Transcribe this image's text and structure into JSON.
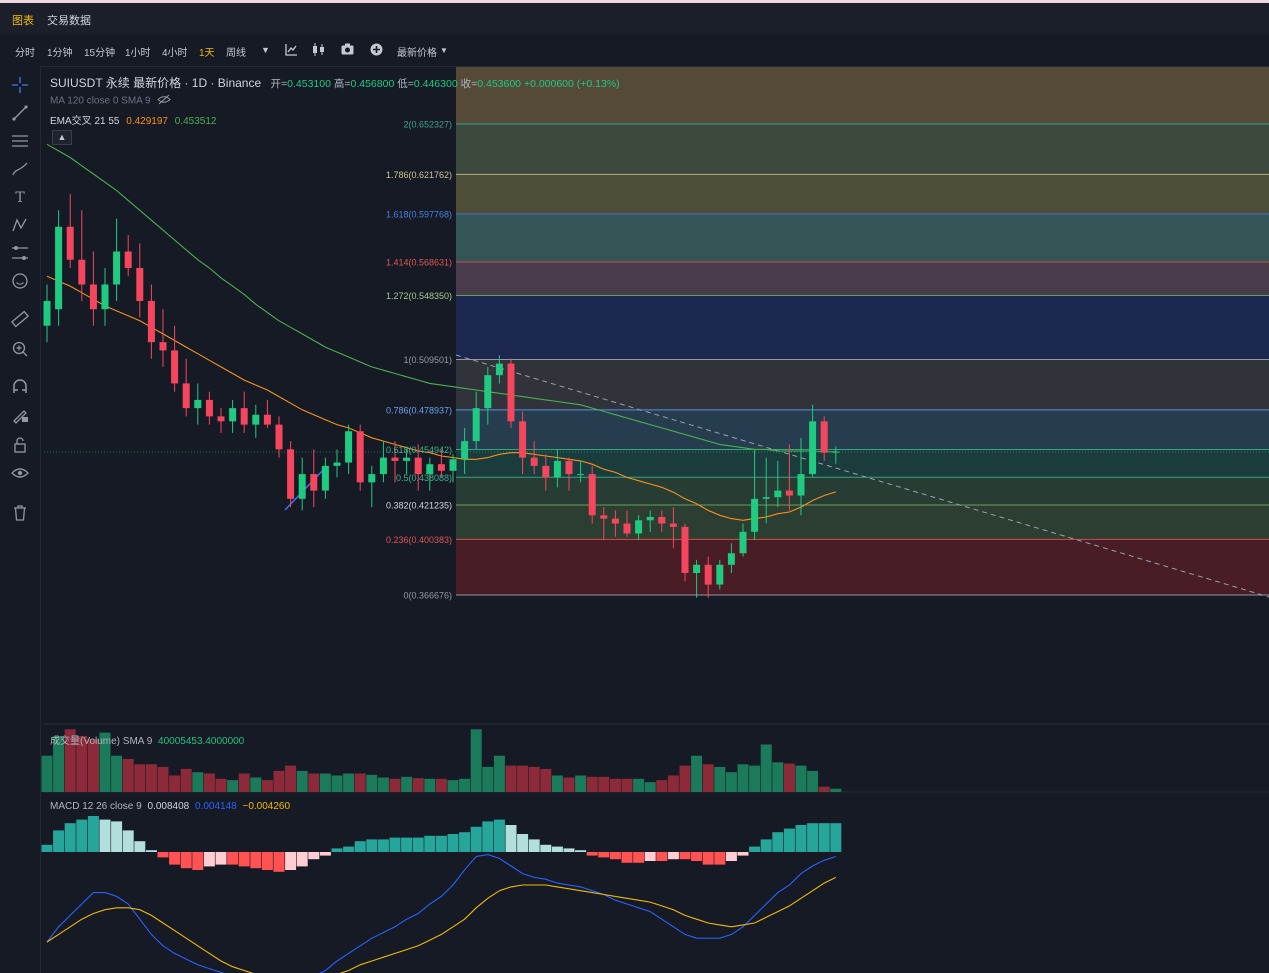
{
  "header_tabs": [
    "图表",
    "交易数据"
  ],
  "timeframes": [
    "分时",
    "1分钟",
    "15分钟",
    "1小时",
    "4小时",
    "1天",
    "周线"
  ],
  "active_timeframe": "1天",
  "price_type_label": "最新价格",
  "legend": {
    "symbol": "SUIUSDT 永续 最新价格 · 1D · Binance",
    "open_label": "开=",
    "open": "0.453100",
    "high_label": "高=",
    "high": "0.456800",
    "low_label": "低=",
    "low": "0.446300",
    "close_label": "收=",
    "close": "0.453600",
    "change": "+0.000600 (+0.13%)",
    "ma_line": "MA 120 close 0 SMA 9",
    "ema_label": "EMA交叉 21 55",
    "ema21": "0.429197",
    "ema55": "0.453512"
  },
  "volume_legend": {
    "label": "成交量(Volume) SMA 9",
    "value": "40005453.4000000"
  },
  "macd_legend": {
    "label": "MACD 12 26 close 9",
    "macd": "0.008408",
    "signal": "0.004148",
    "hist": "−0.004260"
  },
  "colors": {
    "up": "#26a69a",
    "down": "#ef5350",
    "up_candle": "#1ecb81",
    "down_candle": "#f6465d",
    "ema21": "#f7931a",
    "ema55": "#4caf50",
    "macd": "#2962ff",
    "signal": "#f0b90b"
  },
  "chart_data": {
    "type": "candlestick",
    "title": "SUIUSDT 永续 最新价格 · 1D · Binance",
    "fibonacci": [
      {
        "ratio": "2",
        "price": 0.652327,
        "label": "2(0.652327)"
      },
      {
        "ratio": "1.786",
        "price": 0.621762,
        "label": "1.786(0.621762)"
      },
      {
        "ratio": "1.618",
        "price": 0.597768,
        "label": "1.618(0.597768)"
      },
      {
        "ratio": "1.414",
        "price": 0.568631,
        "label": "1.414(0.568631)"
      },
      {
        "ratio": "1.272",
        "price": 0.54835,
        "label": "1.272(0.548350)"
      },
      {
        "ratio": "1",
        "price": 0.509501,
        "label": "1(0.509501)"
      },
      {
        "ratio": "0.786",
        "price": 0.478937,
        "label": "0.786(0.478937)"
      },
      {
        "ratio": "0.618",
        "price": 0.454942,
        "label": "0.618(0.454942)"
      },
      {
        "ratio": "0.5",
        "price": 0.438088,
        "label": "0.5(0.438088)"
      },
      {
        "ratio": "0.382",
        "price": 0.421235,
        "label": "0.382(0.421235)"
      },
      {
        "ratio": "0.236",
        "price": 0.400383,
        "label": "0.236(0.400383)"
      },
      {
        "ratio": "0",
        "price": 0.366676,
        "label": "0(0.366676)"
      }
    ],
    "ohlc": [
      [
        0.53,
        0.555,
        0.52,
        0.545
      ],
      [
        0.54,
        0.6,
        0.53,
        0.59
      ],
      [
        0.59,
        0.61,
        0.565,
        0.57
      ],
      [
        0.57,
        0.6,
        0.545,
        0.555
      ],
      [
        0.555,
        0.575,
        0.53,
        0.54
      ],
      [
        0.54,
        0.565,
        0.53,
        0.555
      ],
      [
        0.555,
        0.595,
        0.545,
        0.575
      ],
      [
        0.575,
        0.585,
        0.56,
        0.565
      ],
      [
        0.565,
        0.58,
        0.535,
        0.545
      ],
      [
        0.545,
        0.555,
        0.51,
        0.52
      ],
      [
        0.52,
        0.54,
        0.505,
        0.515
      ],
      [
        0.515,
        0.53,
        0.49,
        0.495
      ],
      [
        0.495,
        0.51,
        0.475,
        0.48
      ],
      [
        0.48,
        0.495,
        0.47,
        0.485
      ],
      [
        0.485,
        0.49,
        0.47,
        0.475
      ],
      [
        0.475,
        0.48,
        0.465,
        0.472
      ],
      [
        0.472,
        0.485,
        0.465,
        0.48
      ],
      [
        0.48,
        0.49,
        0.465,
        0.47
      ],
      [
        0.47,
        0.482,
        0.462,
        0.476
      ],
      [
        0.476,
        0.485,
        0.468,
        0.47
      ],
      [
        0.47,
        0.475,
        0.45,
        0.455
      ],
      [
        0.455,
        0.46,
        0.42,
        0.425
      ],
      [
        0.425,
        0.45,
        0.418,
        0.44
      ],
      [
        0.44,
        0.455,
        0.42,
        0.43
      ],
      [
        0.43,
        0.45,
        0.425,
        0.445
      ],
      [
        0.445,
        0.455,
        0.438,
        0.447
      ],
      [
        0.447,
        0.47,
        0.44,
        0.466
      ],
      [
        0.466,
        0.47,
        0.43,
        0.435
      ],
      [
        0.435,
        0.445,
        0.42,
        0.44
      ],
      [
        0.44,
        0.46,
        0.435,
        0.45
      ],
      [
        0.45,
        0.46,
        0.435,
        0.448
      ],
      [
        0.448,
        0.455,
        0.44,
        0.45
      ],
      [
        0.45,
        0.458,
        0.43,
        0.44
      ],
      [
        0.44,
        0.45,
        0.43,
        0.446
      ],
      [
        0.446,
        0.455,
        0.438,
        0.442
      ],
      [
        0.442,
        0.452,
        0.435,
        0.449
      ],
      [
        0.449,
        0.468,
        0.44,
        0.46
      ],
      [
        0.46,
        0.49,
        0.455,
        0.48
      ],
      [
        0.48,
        0.505,
        0.47,
        0.5
      ],
      [
        0.5,
        0.512,
        0.495,
        0.507
      ],
      [
        0.507,
        0.51,
        0.468,
        0.472
      ],
      [
        0.472,
        0.478,
        0.44,
        0.45
      ],
      [
        0.45,
        0.46,
        0.44,
        0.445
      ],
      [
        0.445,
        0.452,
        0.43,
        0.438
      ],
      [
        0.438,
        0.455,
        0.432,
        0.448
      ],
      [
        0.448,
        0.45,
        0.43,
        0.44
      ],
      [
        0.44,
        0.448,
        0.435,
        0.44
      ],
      [
        0.44,
        0.445,
        0.41,
        0.415
      ],
      [
        0.415,
        0.42,
        0.4,
        0.413
      ],
      [
        0.413,
        0.418,
        0.402,
        0.41
      ],
      [
        0.41,
        0.418,
        0.402,
        0.404
      ],
      [
        0.404,
        0.415,
        0.4,
        0.412
      ],
      [
        0.412,
        0.418,
        0.405,
        0.414
      ],
      [
        0.414,
        0.418,
        0.405,
        0.41
      ],
      [
        0.41,
        0.42,
        0.395,
        0.408
      ],
      [
        0.408,
        0.41,
        0.375,
        0.38
      ],
      [
        0.38,
        0.388,
        0.365,
        0.385
      ],
      [
        0.385,
        0.39,
        0.365,
        0.373
      ],
      [
        0.373,
        0.388,
        0.37,
        0.385
      ],
      [
        0.385,
        0.398,
        0.38,
        0.392
      ],
      [
        0.392,
        0.41,
        0.39,
        0.405
      ],
      [
        0.405,
        0.455,
        0.4,
        0.425
      ],
      [
        0.425,
        0.45,
        0.41,
        0.426
      ],
      [
        0.426,
        0.448,
        0.42,
        0.43
      ],
      [
        0.43,
        0.458,
        0.418,
        0.427
      ],
      [
        0.427,
        0.462,
        0.415,
        0.44
      ],
      [
        0.44,
        0.482,
        0.438,
        0.472
      ],
      [
        0.472,
        0.475,
        0.448,
        0.453
      ],
      [
        0.4531,
        0.4568,
        0.4463,
        0.4536
      ]
    ],
    "ema21": [
      0.56,
      0.557,
      0.554,
      0.55,
      0.546,
      0.542,
      0.539,
      0.536,
      0.533,
      0.529,
      0.525,
      0.521,
      0.517,
      0.513,
      0.509,
      0.505,
      0.501,
      0.497,
      0.494,
      0.491,
      0.487,
      0.483,
      0.479,
      0.476,
      0.473,
      0.47,
      0.468,
      0.465,
      0.462,
      0.46,
      0.458,
      0.456,
      0.454,
      0.453,
      0.451,
      0.45,
      0.449,
      0.449,
      0.45,
      0.452,
      0.453,
      0.453,
      0.452,
      0.451,
      0.45,
      0.449,
      0.448,
      0.446,
      0.443,
      0.441,
      0.438,
      0.436,
      0.434,
      0.432,
      0.429,
      0.425,
      0.422,
      0.418,
      0.415,
      0.413,
      0.412,
      0.413,
      0.414,
      0.416,
      0.417,
      0.42,
      0.424,
      0.427,
      0.429197
    ],
    "ema55": [
      0.64,
      0.636,
      0.632,
      0.627,
      0.622,
      0.617,
      0.612,
      0.606,
      0.6,
      0.594,
      0.588,
      0.582,
      0.576,
      0.57,
      0.565,
      0.559,
      0.554,
      0.549,
      0.543,
      0.538,
      0.533,
      0.529,
      0.525,
      0.521,
      0.517,
      0.514,
      0.511,
      0.508,
      0.505,
      0.503,
      0.501,
      0.499,
      0.497,
      0.495,
      0.494,
      0.493,
      0.492,
      0.491,
      0.49,
      0.489,
      0.488,
      0.487,
      0.486,
      0.485,
      0.484,
      0.483,
      0.482,
      0.48,
      0.478,
      0.476,
      0.474,
      0.472,
      0.47,
      0.468,
      0.466,
      0.464,
      0.462,
      0.46,
      0.458,
      0.457,
      0.456,
      0.455,
      0.455,
      0.454,
      0.454,
      0.454,
      0.454,
      0.4536,
      0.453512
    ],
    "volume": [
      0.55,
      0.85,
      0.95,
      0.85,
      0.8,
      0.9,
      0.55,
      0.5,
      0.42,
      0.42,
      0.38,
      0.25,
      0.35,
      0.3,
      0.28,
      0.2,
      0.18,
      0.28,
      0.22,
      0.18,
      0.32,
      0.4,
      0.32,
      0.28,
      0.28,
      0.25,
      0.28,
      0.28,
      0.26,
      0.22,
      0.2,
      0.23,
      0.21,
      0.2,
      0.2,
      0.18,
      0.2,
      0.95,
      0.38,
      0.55,
      0.4,
      0.4,
      0.38,
      0.35,
      0.25,
      0.22,
      0.25,
      0.23,
      0.23,
      0.2,
      0.2,
      0.2,
      0.15,
      0.18,
      0.25,
      0.4,
      0.55,
      0.42,
      0.38,
      0.3,
      0.42,
      0.4,
      0.72,
      0.45,
      0.43,
      0.4,
      0.32,
      0.08,
      0.05
    ],
    "macd_hist": [
      0.004,
      0.012,
      0.016,
      0.018,
      0.02,
      0.018,
      0.017,
      0.012,
      0.006,
      0.001,
      -0.003,
      -0.007,
      -0.009,
      -0.01,
      -0.008,
      -0.007,
      -0.007,
      -0.008,
      -0.009,
      -0.01,
      -0.011,
      -0.01,
      -0.008,
      -0.004,
      -0.002,
      0.002,
      0.003,
      0.006,
      0.007,
      0.007,
      0.008,
      0.008,
      0.008,
      0.009,
      0.009,
      0.01,
      0.011,
      0.014,
      0.017,
      0.018,
      0.015,
      0.01,
      0.007,
      0.004,
      0.003,
      0.002,
      0.001,
      -0.002,
      -0.003,
      -0.004,
      -0.006,
      -0.006,
      -0.005,
      -0.005,
      -0.004,
      -0.004,
      -0.005,
      -0.007,
      -0.007,
      -0.005,
      -0.002,
      0.003,
      0.007,
      0.011,
      0.013,
      0.015,
      0.016,
      0.016,
      0.016
    ],
    "macd_line": [
      0.0,
      0.008,
      0.014,
      0.02,
      0.026,
      0.026,
      0.024,
      0.02,
      0.012,
      0.004,
      -0.002,
      -0.006,
      -0.009,
      -0.012,
      -0.014,
      -0.016,
      -0.018,
      -0.02,
      -0.02,
      -0.021,
      -0.021,
      -0.021,
      -0.02,
      -0.018,
      -0.015,
      -0.01,
      -0.006,
      -0.002,
      0.002,
      0.005,
      0.008,
      0.012,
      0.015,
      0.02,
      0.024,
      0.03,
      0.038,
      0.045,
      0.046,
      0.044,
      0.04,
      0.036,
      0.034,
      0.033,
      0.031,
      0.03,
      0.029,
      0.027,
      0.025,
      0.022,
      0.02,
      0.018,
      0.016,
      0.012,
      0.008,
      0.004,
      0.002,
      0.002,
      0.002,
      0.004,
      0.008,
      0.014,
      0.02,
      0.026,
      0.03,
      0.036,
      0.04,
      0.043,
      0.045
    ],
    "signal_line": [
      0.0,
      0.004,
      0.008,
      0.012,
      0.015,
      0.017,
      0.018,
      0.018,
      0.017,
      0.014,
      0.01,
      0.006,
      0.002,
      -0.002,
      -0.006,
      -0.01,
      -0.013,
      -0.015,
      -0.017,
      -0.018,
      -0.019,
      -0.02,
      -0.02,
      -0.02,
      -0.019,
      -0.017,
      -0.015,
      -0.012,
      -0.01,
      -0.008,
      -0.006,
      -0.004,
      -0.002,
      0.001,
      0.004,
      0.008,
      0.012,
      0.018,
      0.023,
      0.027,
      0.029,
      0.03,
      0.03,
      0.03,
      0.029,
      0.028,
      0.027,
      0.026,
      0.025,
      0.024,
      0.023,
      0.022,
      0.021,
      0.019,
      0.017,
      0.014,
      0.012,
      0.01,
      0.009,
      0.008,
      0.009,
      0.01,
      0.013,
      0.016,
      0.019,
      0.023,
      0.027,
      0.031,
      0.034
    ]
  }
}
